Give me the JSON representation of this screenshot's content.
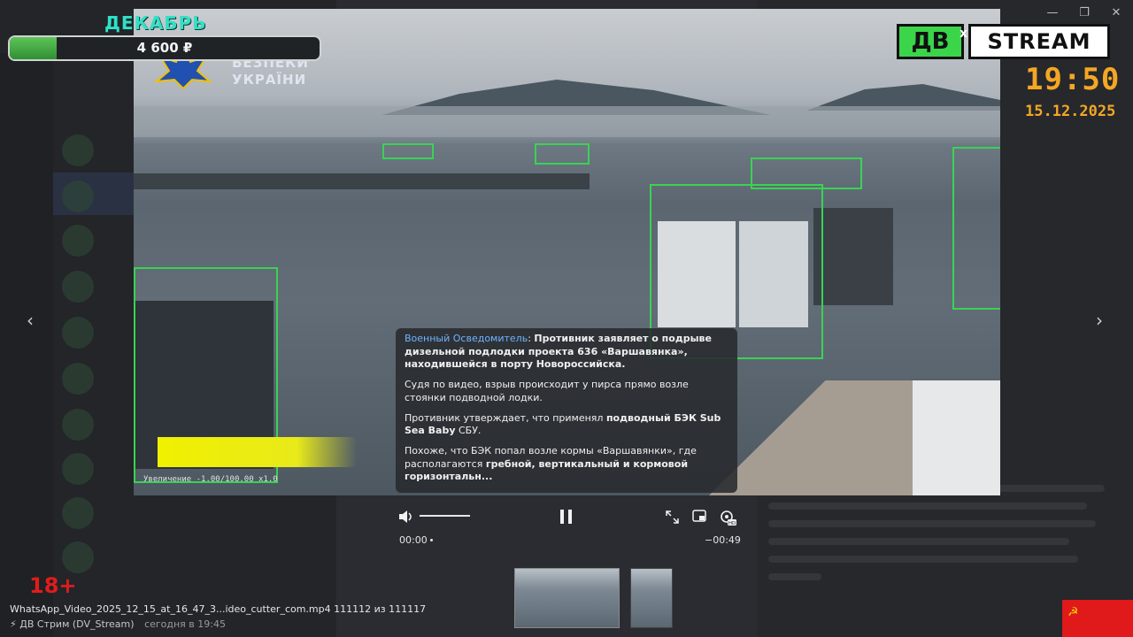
{
  "window": {
    "minimize_icon": "minimize-icon",
    "restore_icon": "restore-icon",
    "close_icon": "close-icon"
  },
  "overlay": {
    "month": "ДЕКАБРЬ",
    "donation_amount": "4 600 ₽",
    "donation_progress": 0.15,
    "sbu_text": "БЕЗПЕКИ УКРАЇНИ",
    "logo_left": "ДВ",
    "logo_x": "x",
    "logo_right": "STREAM",
    "clock": "19:50",
    "date": "15.12.2025",
    "age_rating": "18+",
    "zoom_text": "Увеличение -1.00/100.00 x1.0"
  },
  "caption": {
    "author": "Военный Осведомитель",
    "p1": "Противник заявляет о подрыве дизельной подлодки проекта 636 «Варшавянка», находившейся в порту Новороссийска.",
    "p2": "Судя по видео, взрыв происходит у пирса прямо возле стоянки подводной лодки.",
    "p3_pre": "Противник утверждает, что применял ",
    "p3_bold": "подводный БЭК Sub Sea Baby",
    "p3_post": " СБУ.",
    "p4_pre": "Похоже, что БЭК попал возле кормы «Варшавянки», где располагаются ",
    "p4_bold": "гребной, вертикальный и кормовой горизонтальн..."
  },
  "player": {
    "time_current": "00:00",
    "time_remaining": "−00:49",
    "volume_level": 1.0,
    "progress": 0.0,
    "quality_badge": "HD"
  },
  "media_viewer": {
    "file_name": "WhatsApp_Video_2025_12_15_at_16_47_3...ideo_cutter_com.mp4",
    "counter": "111112 из 111117",
    "author": "⚡ ДВ Стрим (DV_Stream)",
    "sent_time": "сегодня в 19:45"
  }
}
